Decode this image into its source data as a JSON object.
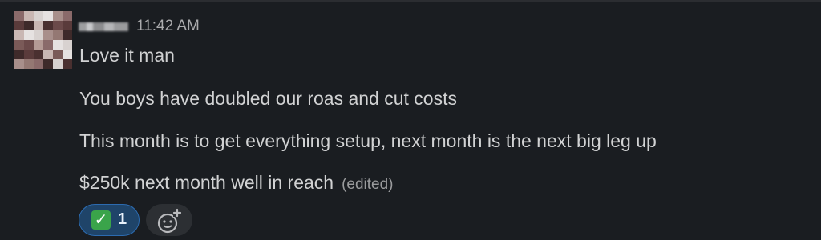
{
  "message": {
    "timestamp": "11:42 AM",
    "lines": [
      "Love it man",
      "You boys have doubled our roas and cut costs",
      "This month is to get everything setup, next month is the next big leg up",
      "$250k next month well in reach"
    ],
    "edited_label": "(edited)"
  },
  "reactions": [
    {
      "emoji": "✓",
      "icon": "check-mark-emoji",
      "count": "1"
    }
  ],
  "colors": {
    "background": "#1a1d21",
    "text": "#d1d2d3",
    "muted": "#ababad",
    "reaction_bg": "#1f4469",
    "reaction_border": "#2c6bb0",
    "check_green": "#3aa44a"
  }
}
